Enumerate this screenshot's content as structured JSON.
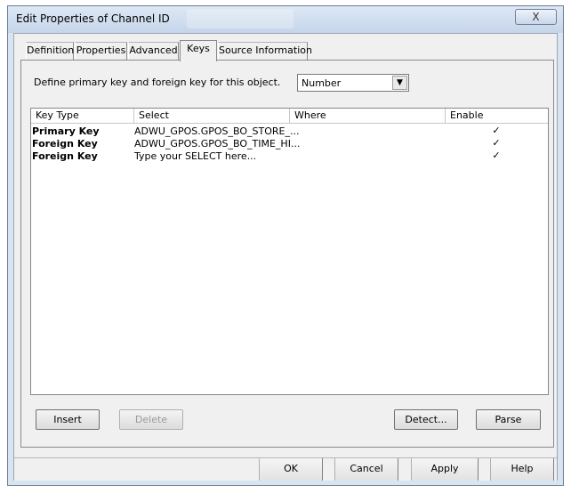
{
  "window": {
    "title": "Edit Properties of Channel ID",
    "close_label": "X"
  },
  "tabs": [
    {
      "label": "Definition"
    },
    {
      "label": "Properties"
    },
    {
      "label": "Advanced"
    },
    {
      "label": "Keys"
    },
    {
      "label": "Source Information"
    }
  ],
  "keys_tab": {
    "define_label": "Define primary key and foreign key for this object.",
    "key_data_type": "Number"
  },
  "table": {
    "columns": [
      "Key Type",
      "Select",
      "Where",
      "Enable"
    ],
    "rows": [
      {
        "key_type": "Primary Key",
        "select": "ADWU_GPOS.GPOS_BO_STORE_...",
        "where": "",
        "enabled": true
      },
      {
        "key_type": "Foreign Key",
        "select": "ADWU_GPOS.GPOS_BO_TIME_HI...",
        "where": "",
        "enabled": true
      },
      {
        "key_type": "Foreign Key",
        "select": "Type your SELECT here...",
        "where": "",
        "enabled": true
      }
    ]
  },
  "actions": {
    "insert": "Insert",
    "delete": "Delete",
    "detect": "Detect...",
    "parse": "Parse"
  },
  "dialog_buttons": {
    "ok": "OK",
    "cancel": "Cancel",
    "apply": "Apply",
    "help": "Help"
  }
}
